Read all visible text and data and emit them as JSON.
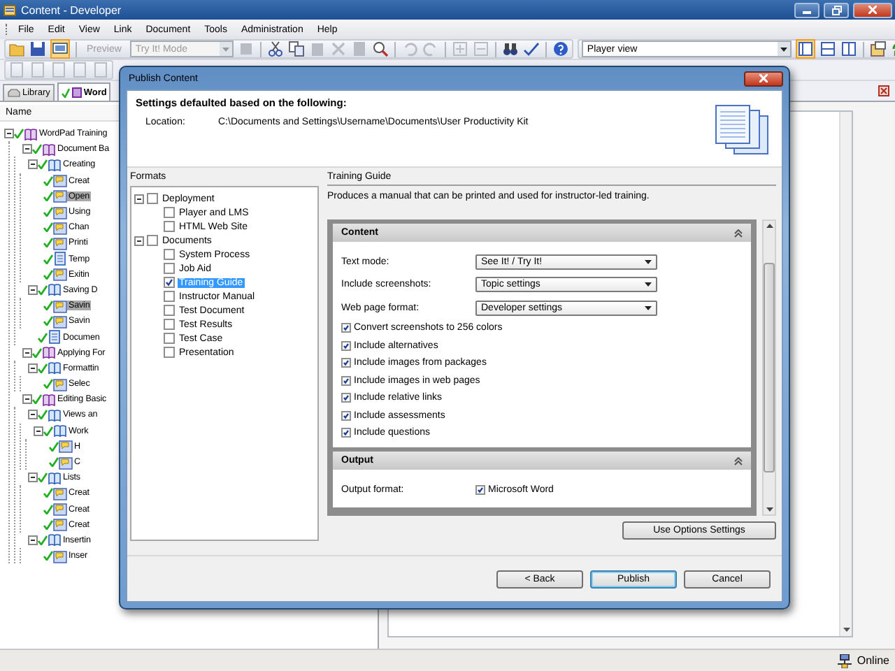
{
  "window": {
    "title": "Content - Developer"
  },
  "menu": [
    "File",
    "Edit",
    "View",
    "Link",
    "Document",
    "Tools",
    "Administration",
    "Help"
  ],
  "toolbar": {
    "preview": {
      "label": "Preview",
      "disabled": true
    },
    "mode": {
      "value": "Try It! Mode",
      "disabled": true
    },
    "view": {
      "value": "Player view",
      "disabled": false
    }
  },
  "tabs": [
    {
      "label": "Library",
      "selected": false
    },
    {
      "label": "Word",
      "selected": true
    }
  ],
  "outline": {
    "column": "Name",
    "items": [
      {
        "label": "WordPad Training",
        "kind": "book",
        "selected": false,
        "children": [
          {
            "label": "Document Ba",
            "kind": "book",
            "selected": false,
            "children": [
              {
                "label": "Creating",
                "kind": "module",
                "selected": false,
                "children": [
                  {
                    "label": "Creat",
                    "kind": "topic",
                    "selected": false
                  },
                  {
                    "label": "Open",
                    "kind": "topic",
                    "selected": true
                  },
                  {
                    "label": "Using",
                    "kind": "topic",
                    "selected": false
                  },
                  {
                    "label": "Chan",
                    "kind": "topic",
                    "selected": false
                  },
                  {
                    "label": "Printi",
                    "kind": "topic",
                    "selected": false
                  },
                  {
                    "label": "Temp",
                    "kind": "document",
                    "selected": false
                  },
                  {
                    "label": "Exitin",
                    "kind": "topic",
                    "selected": false
                  }
                ]
              },
              {
                "label": "Saving D",
                "kind": "module",
                "selected": false,
                "children": [
                  {
                    "label": "Savin",
                    "kind": "topic",
                    "selected": true
                  },
                  {
                    "label": "Savin",
                    "kind": "topic",
                    "selected": false
                  }
                ]
              },
              {
                "label": "Documen",
                "kind": "document",
                "selected": false
              }
            ]
          },
          {
            "label": "Applying For",
            "kind": "book",
            "selected": false,
            "children": [
              {
                "label": "Formattin",
                "kind": "module",
                "selected": false,
                "children": [
                  {
                    "label": "Selec",
                    "kind": "topic",
                    "selected": false
                  }
                ]
              }
            ]
          },
          {
            "label": "Editing Basic",
            "kind": "book",
            "selected": false,
            "children": [
              {
                "label": "Views an",
                "kind": "module",
                "selected": false,
                "children": [
                  {
                    "label": "Work",
                    "kind": "module",
                    "selected": false,
                    "children": [
                      {
                        "label": "H",
                        "kind": "topic",
                        "selected": false
                      },
                      {
                        "label": "C",
                        "kind": "topic",
                        "selected": false
                      }
                    ]
                  }
                ]
              },
              {
                "label": "Lists",
                "kind": "module",
                "selected": false,
                "children": [
                  {
                    "label": "Creat",
                    "kind": "topic",
                    "selected": false
                  },
                  {
                    "label": "Creat",
                    "kind": "topic",
                    "selected": false
                  },
                  {
                    "label": "Creat",
                    "kind": "topic",
                    "selected": false
                  }
                ]
              },
              {
                "label": "Insertin",
                "kind": "module",
                "selected": false,
                "children": [
                  {
                    "label": "Inser",
                    "kind": "topic",
                    "selected": false
                  }
                ]
              }
            ]
          }
        ]
      }
    ]
  },
  "dialog": {
    "title": "Publish Content",
    "heading": "Settings defaulted based on the following:",
    "location": {
      "label": "Location:",
      "value": "C:\\Documents and Settings\\Username\\Documents\\User Productivity Kit"
    },
    "formats": {
      "label": "Formats",
      "items": [
        {
          "label": "Deployment",
          "checked": false,
          "selected": false,
          "children": [
            {
              "label": "Player and LMS",
              "checked": false,
              "selected": false
            },
            {
              "label": "HTML Web Site",
              "checked": false,
              "selected": false
            }
          ]
        },
        {
          "label": "Documents",
          "checked": false,
          "selected": false,
          "children": [
            {
              "label": "System Process",
              "checked": false,
              "selected": false
            },
            {
              "label": "Job Aid",
              "checked": false,
              "selected": false
            },
            {
              "label": "Training Guide",
              "checked": true,
              "selected": true
            },
            {
              "label": "Instructor Manual",
              "checked": false,
              "selected": false
            },
            {
              "label": "Test Document",
              "checked": false,
              "selected": false
            },
            {
              "label": "Test Results",
              "checked": false,
              "selected": false
            },
            {
              "label": "Test Case",
              "checked": false,
              "selected": false
            },
            {
              "label": "Presentation",
              "checked": false,
              "selected": false
            }
          ]
        }
      ]
    },
    "details": {
      "title": "Training Guide",
      "description": "Produces a manual that can be printed and used for instructor-led training.",
      "sections": [
        {
          "title": "Content",
          "rows": [
            {
              "kind": "select",
              "label": "Text mode:",
              "value": "See It! / Try It!"
            },
            {
              "kind": "select",
              "label": "Include screenshots:",
              "value": "Topic settings"
            },
            {
              "kind": "select",
              "label": "Web page format:",
              "value": "Developer settings"
            },
            {
              "kind": "checkbox",
              "label": "Convert screenshots to 256 colors",
              "checked": true
            },
            {
              "kind": "checkbox",
              "label": "Include alternatives",
              "checked": true
            },
            {
              "kind": "checkbox",
              "label": "Include images from packages",
              "checked": true
            },
            {
              "kind": "checkbox",
              "label": "Include images in web pages",
              "checked": true
            },
            {
              "kind": "checkbox",
              "label": "Include relative links",
              "checked": true
            },
            {
              "kind": "checkbox",
              "label": "Include assessments",
              "checked": true
            },
            {
              "kind": "checkbox",
              "label": "Include questions",
              "checked": true
            }
          ]
        },
        {
          "title": "Output",
          "rows": [
            {
              "kind": "labeled_checkbox",
              "label": "Output format:",
              "option": "Microsoft Word",
              "checked": true
            }
          ]
        }
      ]
    },
    "options_button": "Use Options Settings",
    "buttons": [
      {
        "label": "< Back",
        "default": false
      },
      {
        "label": "Publish",
        "default": true
      },
      {
        "label": "Cancel",
        "default": false
      }
    ]
  },
  "status_bar": {
    "text": "Online"
  }
}
